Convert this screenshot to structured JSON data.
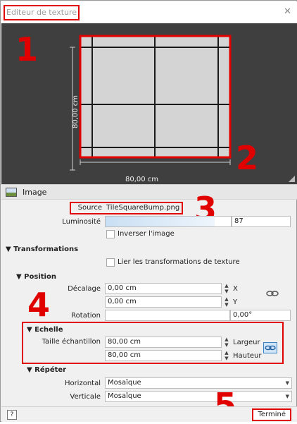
{
  "window": {
    "title": "Editeur de texture",
    "close_glyph": "✕"
  },
  "preview": {
    "width_label": "80,00 cm",
    "height_label": "80,00 cm"
  },
  "callouts": [
    "1",
    "2",
    "3",
    "4",
    "5"
  ],
  "image_section": {
    "label": "Image",
    "icon": "image-icon"
  },
  "source": {
    "label": "Source",
    "value": "TileSquareBump.png"
  },
  "luminosite": {
    "label": "Luminosité",
    "value": "87",
    "level": 0.87
  },
  "invert": {
    "label": "Inverser l'image",
    "checked": false
  },
  "transformations": {
    "header": "▼ Transformations",
    "link_label": "Lier les transformations de texture",
    "link_checked": false
  },
  "position": {
    "header": "▼ Position",
    "offset_label": "Décalage",
    "offset_x": "0,00 cm",
    "offset_y": "0,00 cm",
    "x_label": "X",
    "y_label": "Y",
    "rotation_label": "Rotation",
    "rotation_value": "0,00°"
  },
  "scale": {
    "header": "▼ Echelle",
    "sample_label": "Taille échantillon",
    "width_value": "80,00 cm",
    "height_value": "80,00 cm",
    "width_label": "Largeur",
    "height_label": "Hauteur"
  },
  "repeat": {
    "header": "▼ Répéter",
    "horizontal_label": "Horizontal",
    "horizontal_value": "Mosaïque",
    "vertical_label": "Verticale",
    "vertical_value": "Mosaïque"
  },
  "footer": {
    "help": "?",
    "done": "Terminé"
  },
  "colors": {
    "callout_red": "#e00000",
    "canvas_bg": "#3f3f3f"
  }
}
